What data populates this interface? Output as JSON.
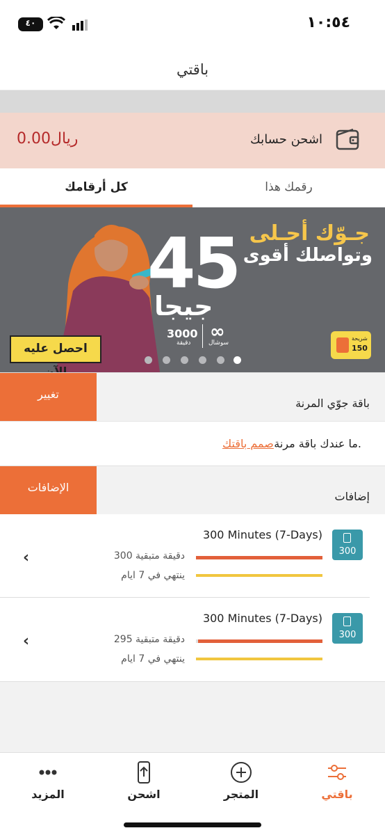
{
  "status_bar": {
    "time": "١٠:٥٤",
    "battery": "٤٠"
  },
  "header": {
    "title": "باقتي"
  },
  "recharge": {
    "label": "اشحن حسابك",
    "balance": "0.00ريال"
  },
  "tabs": {
    "all_numbers": "كل أرقامك",
    "this_number": "رقمك هذا"
  },
  "banner": {
    "headline1": "جـوّك أحـلى",
    "headline2": "وتواصلك أقوى",
    "big_number": "45",
    "unit": "جيجا",
    "minutes": "3000",
    "minutes_label": "دقيقة",
    "social_label": "سوشال",
    "social_symbol": "∞",
    "cta": "احصل عليه الآن",
    "sim_label": "شريحة",
    "sim_price": "150",
    "slides_total": 6,
    "active_slide": 6
  },
  "plan": {
    "name": "باقة جوّي المرنة",
    "change_label": "تغيير"
  },
  "flex_notice": {
    "text": "ما عندك باقة مرنة.",
    "link": "صمم باقتك"
  },
  "addons": {
    "title": "إضافات",
    "button_label": "الإضافات"
  },
  "bundles": [
    {
      "badge": "300",
      "title": "300 Minutes (7-Days)",
      "remaining": "300 دقيقة متبقية",
      "expiry": "ينتهي في 7 ايام",
      "remaining_fraction": 1.0
    },
    {
      "badge": "300",
      "title": "300 Minutes (7-Days)",
      "remaining": "295 دقيقة متبقية",
      "expiry": "ينتهي في 7 ايام",
      "remaining_fraction": 0.983
    }
  ],
  "bottom_nav": {
    "my_plan": "باقتي",
    "store": "المتجر",
    "recharge": "اشحن",
    "more": "المزيد"
  },
  "colors": {
    "accent": "#ec6f38",
    "teal": "#3a99a9",
    "balance_red": "#b52a2a",
    "banner_bg": "#65676b",
    "yellow": "#f6d94b"
  }
}
